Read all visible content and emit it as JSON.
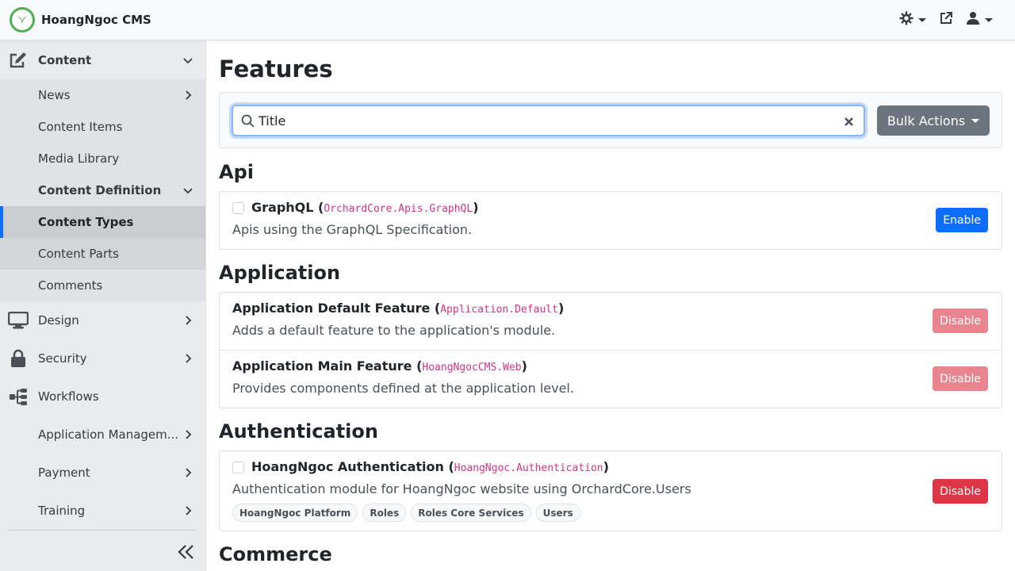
{
  "header": {
    "brand_name": "HoangNgoc CMS",
    "icons": [
      "theme-toggle-icon",
      "external-link-icon",
      "user-icon"
    ]
  },
  "sidebar": {
    "content": {
      "label": "Content",
      "items": [
        {
          "label": "News"
        },
        {
          "label": "Content Items"
        },
        {
          "label": "Media Library"
        }
      ],
      "definition": {
        "label": "Content Definition",
        "items": [
          {
            "label": "Content Types",
            "active": true
          },
          {
            "label": "Content Parts"
          }
        ]
      },
      "comments": "Comments"
    },
    "sections": [
      {
        "label": "Design",
        "icon": "monitor-icon"
      },
      {
        "label": "Security",
        "icon": "lock-icon"
      },
      {
        "label": "Workflows",
        "icon": "workflow-icon"
      },
      {
        "label": "Application Managem..."
      },
      {
        "label": "Payment"
      },
      {
        "label": "Training"
      }
    ]
  },
  "main": {
    "title": "Features",
    "search": {
      "value": "Title"
    },
    "bulk_actions_label": "Bulk Actions",
    "categories": [
      {
        "name": "Api",
        "features": [
          {
            "name": "GraphQL",
            "id": "OrchardCore.Apis.GraphQL",
            "description": "Apis using the GraphQL Specification.",
            "action": "Enable",
            "has_checkbox": true
          }
        ]
      },
      {
        "name": "Application",
        "features": [
          {
            "name": "Application Default Feature",
            "id": "Application.Default",
            "description": "Adds a default feature to the application's module.",
            "action": "Disable",
            "has_checkbox": false
          },
          {
            "name": "Application Main Feature",
            "id": "HoangNgocCMS.Web",
            "description": "Provides components defined at the application level.",
            "action": "Disable",
            "has_checkbox": false
          }
        ]
      },
      {
        "name": "Authentication",
        "features": [
          {
            "name": "HoangNgoc Authentication",
            "id": "HoangNgoc.Authentication",
            "description": "Authentication module for HoangNgoc website using OrchardCore.Users",
            "action": "Disable",
            "has_checkbox": true,
            "dependencies": [
              "HoangNgoc Platform",
              "Roles",
              "Roles Core Services",
              "Users"
            ]
          }
        ]
      },
      {
        "name": "Commerce",
        "features": []
      }
    ]
  },
  "colors": {
    "primary": "#0d6efd",
    "danger": "#dc3545",
    "secondary": "#6c757d",
    "code": "#d63384",
    "brand": "#4caf50"
  }
}
